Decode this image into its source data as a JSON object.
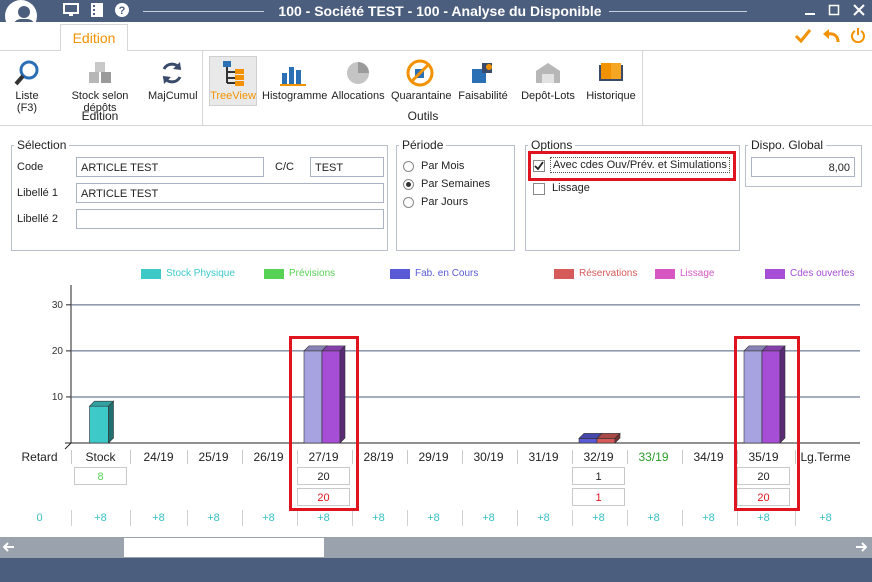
{
  "window": {
    "title": "100 - Société TEST - 100 - Analyse du Disponible"
  },
  "ribbon": {
    "tab": "Edition",
    "groups": [
      {
        "label": "Edition",
        "buttons": [
          {
            "label": "Liste (F3)",
            "icon": "search-icon",
            "enabled": true
          },
          {
            "label": "Stock selon dépôts",
            "icon": "boxes-icon",
            "enabled": false
          },
          {
            "label": "MajCumul",
            "icon": "refresh-icon",
            "enabled": true
          }
        ]
      },
      {
        "label": "Outils",
        "buttons": [
          {
            "label": "TreeView",
            "icon": "treeview-icon",
            "enabled": true,
            "selected": true
          },
          {
            "label": "Histogramme",
            "icon": "histogram-icon",
            "enabled": true
          },
          {
            "label": "Allocations",
            "icon": "pie-icon",
            "enabled": false
          },
          {
            "label": "Quarantaine",
            "icon": "quarantine-icon",
            "enabled": true
          },
          {
            "label": "Faisabilité",
            "icon": "feasibility-icon",
            "enabled": true
          },
          {
            "label": "Depôt-Lots",
            "icon": "warehouse-icon",
            "enabled": false
          },
          {
            "label": "Historique",
            "icon": "book-icon",
            "enabled": true
          }
        ]
      }
    ]
  },
  "selection": {
    "legend": "Sélection",
    "code_label": "Code",
    "code_value": "ARTICLE TEST",
    "cc_label": "C/C",
    "cc_value": "TEST",
    "libelle1_label": "Libellé 1",
    "libelle1_value": "ARTICLE TEST",
    "libelle2_label": "Libellé 2",
    "libelle2_value": ""
  },
  "periode": {
    "legend": "Période",
    "options": [
      "Par Mois",
      "Par Semaines",
      "Par Jours"
    ],
    "selected": "Par Semaines"
  },
  "options": {
    "legend": "Options",
    "cdes_label": "Avec cdes Ouv/Prév. et Simulations",
    "cdes_checked": true,
    "lissage_label": "Lissage",
    "lissage_checked": false
  },
  "dispo": {
    "legend": "Dispo. Global",
    "value": "8,00"
  },
  "chart_data": {
    "type": "bar",
    "legend": [
      {
        "name": "Stock Physique",
        "color": "#3ec9c9"
      },
      {
        "name": "Prévisions",
        "color": "#57d257"
      },
      {
        "name": "Fab. en Cours",
        "color": "#5a5ad6"
      },
      {
        "name": "Réservations",
        "color": "#d65a5a"
      },
      {
        "name": "Lissage",
        "color": "#d657c1"
      },
      {
        "name": "Cdes ouvertes",
        "color": "#a64fd6"
      }
    ],
    "ylim": [
      0,
      33
    ],
    "yticks": [
      10,
      20,
      30
    ],
    "grid": true,
    "categories": [
      "Retard",
      "Stock",
      "24/19",
      "25/19",
      "26/19",
      "27/19",
      "28/19",
      "29/19",
      "30/19",
      "31/19",
      "32/19",
      "33/19",
      "34/19",
      "35/19",
      "Lg.Terme"
    ],
    "highlighted_categories": [
      "33/19"
    ],
    "bars": [
      {
        "category": "Stock",
        "series": "Stock Physique",
        "value": 8
      },
      {
        "category": "27/19",
        "series": "Fab. en Cours",
        "value": 20
      },
      {
        "category": "27/19",
        "series": "Cdes ouvertes",
        "value": 20
      },
      {
        "category": "32/19",
        "series": "Fab. en Cours",
        "value": 1
      },
      {
        "category": "32/19",
        "series": "Réservations",
        "value": 1
      },
      {
        "category": "35/19",
        "series": "Fab. en Cours",
        "value": 20
      },
      {
        "category": "35/19",
        "series": "Cdes ouvertes",
        "value": 20
      }
    ],
    "value_boxes": [
      {
        "category": "Stock",
        "rows": [
          "8"
        ],
        "colors": [
          "#57d257"
        ]
      },
      {
        "category": "27/19",
        "rows": [
          "20",
          "20"
        ],
        "colors": [
          "#222222",
          "#e0141e"
        ]
      },
      {
        "category": "32/19",
        "rows": [
          "1",
          "1"
        ],
        "colors": [
          "#222222",
          "#e0141e"
        ]
      },
      {
        "category": "35/19",
        "rows": [
          "20",
          "20"
        ],
        "colors": [
          "#222222",
          "#e0141e"
        ]
      }
    ],
    "cumulative": [
      "0",
      "+8",
      "+8",
      "+8",
      "+8",
      "+8",
      "+8",
      "+8",
      "+8",
      "+8",
      "+8",
      "+8",
      "+8",
      "+8",
      "+8"
    ]
  }
}
